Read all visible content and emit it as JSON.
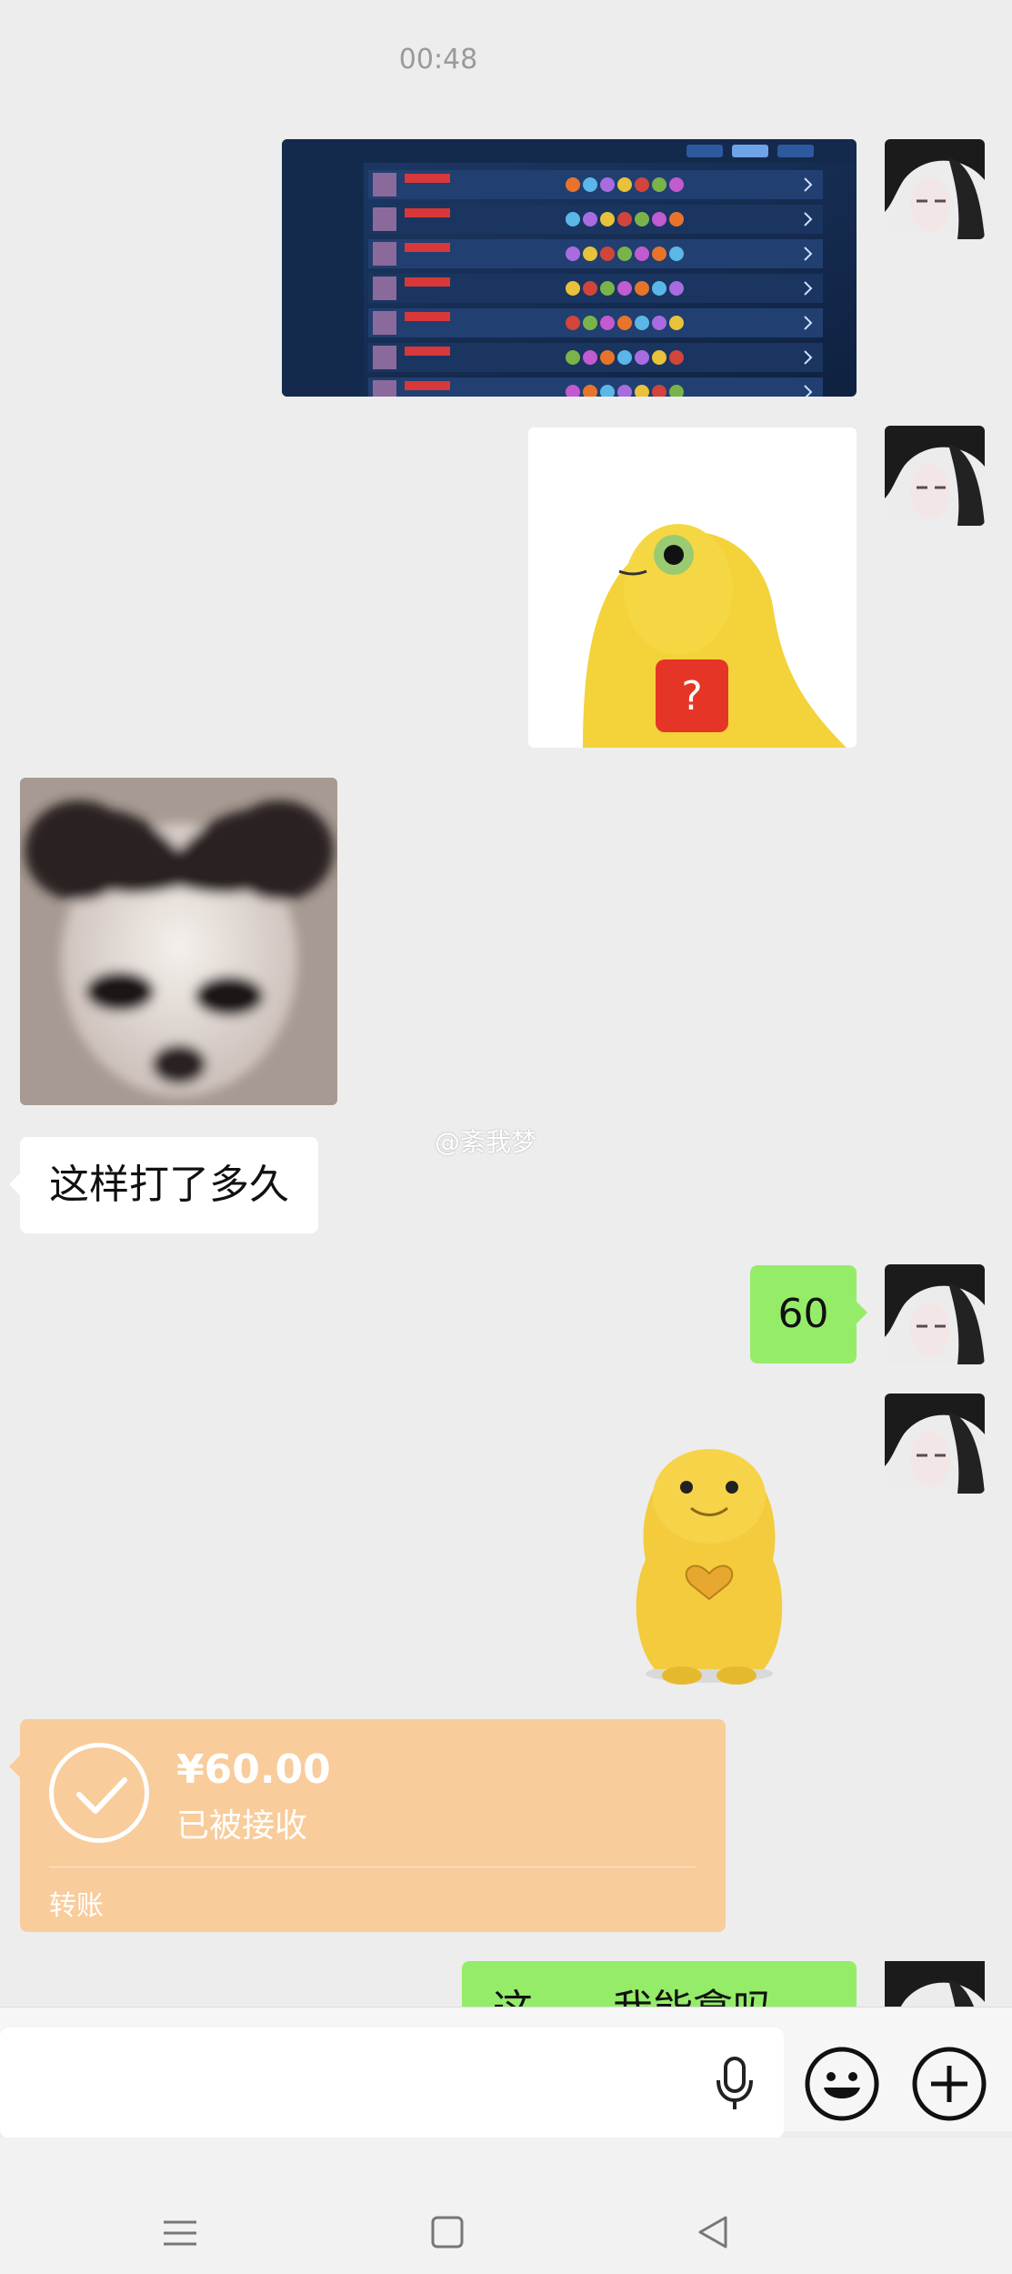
{
  "status": {
    "time": "00:48"
  },
  "messages": {
    "m1": {
      "side": "right",
      "kind": "image",
      "icon": "game-match-history-screenshot"
    },
    "m2": {
      "side": "right",
      "kind": "sticker",
      "icon": "yellow-creature-question-sticker",
      "badge": "?"
    },
    "m3": {
      "side": "left",
      "kind": "sticker",
      "icon": "blurry-dog-face-sticker"
    },
    "m4": {
      "side": "left",
      "kind": "text",
      "text": "这样打了多久"
    },
    "m5": {
      "side": "right",
      "kind": "text",
      "text": "60"
    },
    "m6": {
      "side": "right",
      "kind": "sticker",
      "icon": "yellow-creature-heart-sticker"
    },
    "m7": {
      "side": "left",
      "kind": "transfer",
      "amount": "¥60.00",
      "status": "已被接收",
      "label": "转账"
    },
    "m8": {
      "side": "right",
      "kind": "text",
      "text": "这……我能拿吗"
    }
  },
  "watermark": "@紊我梦",
  "input": {
    "placeholder": "",
    "voice_icon": "microphone-icon",
    "emoji_icon": "smiley-icon",
    "more_icon": "plus-circle-icon"
  },
  "nav": {
    "menu_icon": "menu-icon",
    "home_icon": "square-home-icon",
    "back_icon": "triangle-back-icon"
  },
  "colors": {
    "background": "#ededed",
    "sent_bubble": "#95ec69",
    "received_bubble": "#ffffff",
    "transfer_card": "#f9cc9b"
  }
}
